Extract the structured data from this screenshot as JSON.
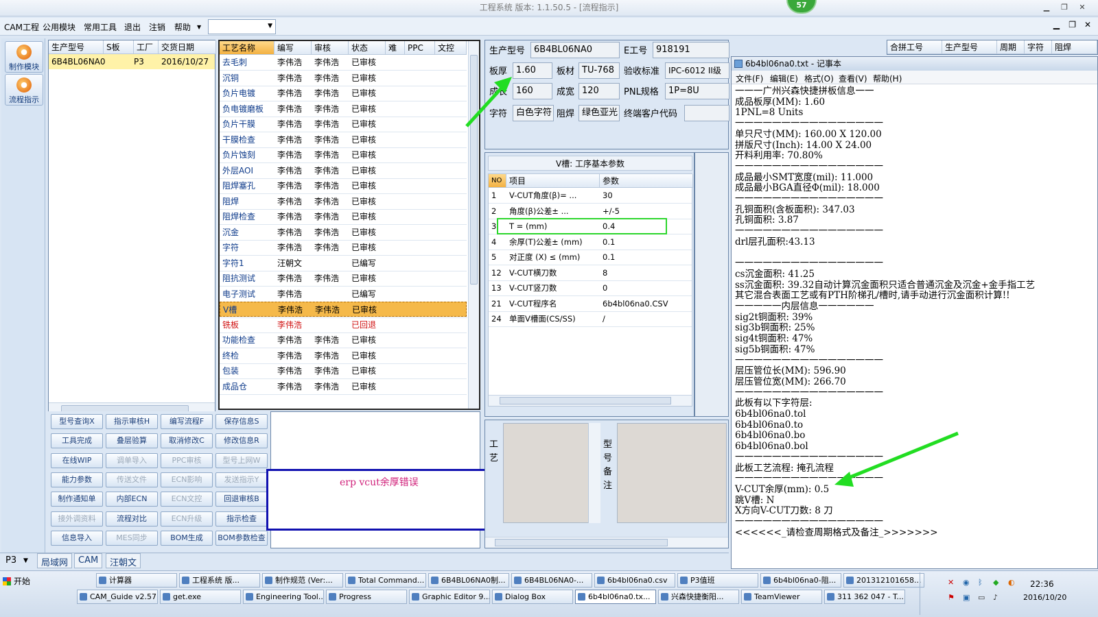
{
  "window": {
    "title": "工程系统  版本: 1.1.50.5 - [流程指示]",
    "badge": "57"
  },
  "menu": [
    "CAM工程",
    "公用模块",
    "常用工具",
    "退出",
    "注销",
    "帮助"
  ],
  "left_buttons": [
    {
      "label": "制作模块",
      "icon": "fire-icon"
    },
    {
      "label": "流程指示",
      "icon": "flow-icon"
    }
  ],
  "orders": {
    "headers": [
      "生产型号",
      "S板",
      "工厂",
      "交货日期"
    ],
    "rows": [
      [
        "6B4BL06NA0",
        "",
        "P3",
        "2016/10/27"
      ]
    ]
  },
  "process": {
    "headers": [
      "工艺名称",
      "编写",
      "审核",
      "状态",
      "难",
      "PPC",
      "文控"
    ],
    "rows": [
      [
        "去毛刺",
        "李伟浩",
        "李伟浩",
        "已审核"
      ],
      [
        "沉铜",
        "李伟浩",
        "李伟浩",
        "已审核"
      ],
      [
        "负片电镀",
        "李伟浩",
        "李伟浩",
        "已审核"
      ],
      [
        "负电镀磨板",
        "李伟浩",
        "李伟浩",
        "已审核"
      ],
      [
        "负片干膜",
        "李伟浩",
        "李伟浩",
        "已审核"
      ],
      [
        "干膜检查",
        "李伟浩",
        "李伟浩",
        "已审核"
      ],
      [
        "负片蚀刻",
        "李伟浩",
        "李伟浩",
        "已审核"
      ],
      [
        "外层AOI",
        "李伟浩",
        "李伟浩",
        "已审核"
      ],
      [
        "阻焊塞孔",
        "李伟浩",
        "李伟浩",
        "已审核"
      ],
      [
        "阻焊",
        "李伟浩",
        "李伟浩",
        "已审核"
      ],
      [
        "阻焊检查",
        "李伟浩",
        "李伟浩",
        "已审核"
      ],
      [
        "沉金",
        "李伟浩",
        "李伟浩",
        "已审核"
      ],
      [
        "字符",
        "李伟浩",
        "李伟浩",
        "已审核"
      ],
      [
        "字符1",
        "汪朝文",
        "",
        "已编写"
      ],
      [
        "阻抗测试",
        "李伟浩",
        "李伟浩",
        "已审核"
      ],
      [
        "电子测试",
        "李伟浩",
        "",
        "已编写"
      ],
      [
        "V槽",
        "李伟浩",
        "李伟浩",
        "已审核"
      ],
      [
        "铣板",
        "李伟浩",
        "",
        "已回退"
      ],
      [
        "功能检查",
        "李伟浩",
        "李伟浩",
        "已审核"
      ],
      [
        "终检",
        "李伟浩",
        "李伟浩",
        "已审核"
      ],
      [
        "包装",
        "李伟浩",
        "李伟浩",
        "已审核"
      ],
      [
        "成品仓",
        "李伟浩",
        "李伟浩",
        "已审核"
      ]
    ],
    "selected_index": 16,
    "returned_index": 17
  },
  "actions": [
    [
      "型号查询X",
      "指示审核H",
      "编写流程F",
      "保存信息S"
    ],
    [
      "工具完成",
      "叠层验算",
      "取消修改C",
      "修改信息R"
    ],
    [
      "在线WIP",
      "调单导入",
      "PPC审核",
      "型号上网W"
    ],
    [
      "能力参数",
      "传送文件",
      "ECN影响",
      "发送指示Y"
    ],
    [
      "制作通知单",
      "内部ECN",
      "ECN文控",
      "回退审核B"
    ],
    [
      "接外调资料",
      "流程对比",
      "ECN升级",
      "指示检查"
    ],
    [
      "信息导入",
      "MES同步",
      "BOM生成",
      "BOM参数检查"
    ]
  ],
  "disabled_actions": [
    "调单导入",
    "PPC审核",
    "型号上网W",
    "传送文件",
    "ECN影响",
    "发送指示Y",
    "ECN文控",
    "接外调资料",
    "ECN升级",
    "MES同步"
  ],
  "note_text": "erp vcut余厚错误",
  "info": {
    "model_label": "生产型号",
    "model": "6B4BL06NA0",
    "eno_label": "E工号",
    "eno": "918191",
    "thick_label": "板厚",
    "thick": "1.60",
    "mat_label": "板材",
    "mat": "TU-768",
    "std_label": "验收标准",
    "std": "IPC-6012 II级",
    "len_label": "成长",
    "len": "160",
    "wid_label": "成宽",
    "wid": "120",
    "pnl_label": "PNL规格",
    "pnl": "1P=8U",
    "char_label": "字符",
    "char": "白色字符",
    "mask_label": "阻焊",
    "mask": "绿色亚光",
    "cust_label": "终端客户代码",
    "cust": ""
  },
  "vcut": {
    "title": "V槽: 工序基本参数",
    "headers": [
      "NO",
      "项目",
      "参数"
    ],
    "rows": [
      [
        "1",
        "V-CUT角度(β)=  ...",
        "30"
      ],
      [
        "2",
        "角度(β)公差±  ...",
        "+/-5"
      ],
      [
        "3",
        "T =  (mm)",
        "0.4"
      ],
      [
        "4",
        "余厚(T)公差±  (mm)",
        "0.1"
      ],
      [
        "5",
        "对正度 (X) ≤ (mm)",
        "0.1"
      ],
      [
        "12",
        "V-CUT横刀数",
        "8"
      ],
      [
        "13",
        "V-CUT竖刀数",
        "0"
      ],
      [
        "21",
        "V-CUT程序名",
        "6b4bl06na0.CSV"
      ],
      [
        "24",
        "单面V槽面(CS/SS)",
        "/"
      ]
    ]
  },
  "side_labels": {
    "process": "工艺",
    "remark": "型号备注"
  },
  "right_headers": [
    "合拼工号",
    "生产型号",
    "周期",
    "字符",
    "阻焊"
  ],
  "notepad": {
    "title": "6b4bl06na0.txt - 记事本",
    "menu": [
      "文件(F)",
      "编辑(E)",
      "格式(O)",
      "查看(V)",
      "帮助(H)"
    ],
    "lines": [
      "一一一广州兴森快捷拼板信息一一",
      "成品板厚(MM): 1.60",
      "1PNL=8 Units",
      "一一一一一一一一一一一一一一一一",
      "单只尺寸(MM): 160.00 X 120.00",
      "拼版尺寸(Inch): 14.00 X 24.00",
      "开料利用率: 70.80%",
      "一一一一一一一一一一一一一一一一",
      "成品最小SMT宽度(mil): 11.000",
      "成品最小BGA直径Φ(mil): 18.000",
      "一一一一一一一一一一一一一一一一",
      "孔铜面积(含板面积): 347.03",
      "孔铜面积: 3.87",
      "一一一一一一一一一一一一一一一一",
      "drl层孔面积:43.13",
      "",
      "一一一一一一一一一一一一一一一一",
      "cs沉金面积: 41.25",
      "ss沉金面积: 39.32自动计算沉金面积只适合普通沉金及沉金+金手指工艺",
      "其它混合表面工艺或有PTH阶梯孔/槽时,请手动进行沉金面积计算!!",
      "一一一一一内层信息一一一一一一",
      "sig2t铜面积: 39%",
      "sig3b铜面积: 25%",
      "sig4t铜面积: 47%",
      "sig5b铜面积: 47%",
      "一一一一一一一一一一一一一一一一",
      "层压管位长(MM): 596.90",
      "层压管位宽(MM): 266.70",
      "一一一一一一一一一一一一一一一一",
      "此板有以下字符层:",
      "6b4bl06na0.tol",
      "6b4bl06na0.to",
      "6b4bl06na0.bo",
      "6b4bl06na0.bol",
      "一一一一一一一一一一一一一一一一",
      "此板工艺流程: 掩孔流程",
      "一一一一一一一一一一一一一一一一",
      "V-CUT余厚(mm): 0.5",
      "跳V槽: N",
      "X方向V-CUT刀数: 8 刀",
      "一一一一一一一一一一一一一一一一",
      "<<<<<<_请检查周期格式及备注_>>>>>>>"
    ]
  },
  "status_tabs": [
    "P3",
    "局域网",
    "CAM",
    "汪朝文"
  ],
  "taskbar": {
    "start": "开始",
    "row1": [
      "计算器",
      "工程系统  版...",
      "制作规范 (Ver:...",
      "Total Command...",
      "6B4BL06NA0制...",
      "6B4BL06NA0-...",
      "6b4bl06na0.csv",
      "P3值班",
      "6b4bl06na0-阻...",
      "201312101658..."
    ],
    "row2": [
      "CAM_Guide v2.57",
      "get.exe",
      "Engineering Tool...",
      "Progress",
      "Graphic Editor 9...",
      "Dialog Box",
      "6b4bl06na0.tx...",
      "兴森快捷衡阳...",
      "TeamViewer",
      "311 362 047 - T..."
    ],
    "clock": "22:36",
    "date": "2016/10/20"
  },
  "colors": {
    "highlight_row": "#f5b94a",
    "arrow": "#22dd22",
    "note_border": "#1010b0",
    "note_text": "#d0207a"
  }
}
